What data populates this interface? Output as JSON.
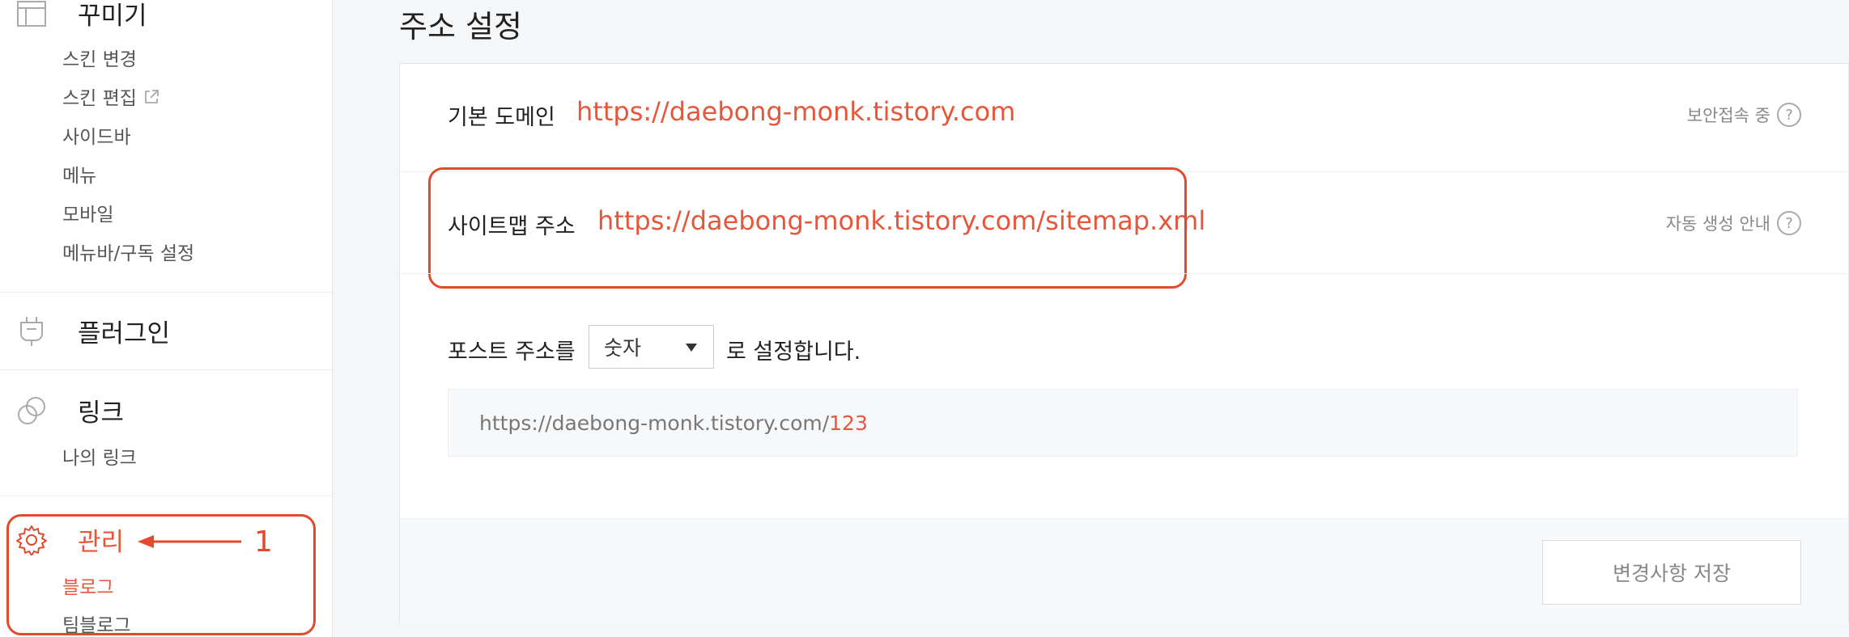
{
  "sidebar": {
    "decorate": {
      "title": "꾸미기",
      "items": [
        "스킨 변경",
        "스킨 편집",
        "사이드바",
        "메뉴",
        "모바일",
        "메뉴바/구독 설정"
      ]
    },
    "plugin": {
      "title": "플러그인"
    },
    "link": {
      "title": "링크",
      "items": [
        "나의 링크"
      ]
    },
    "manage": {
      "title": "관리",
      "items": [
        "블로그",
        "팀블로그"
      ]
    },
    "annotation_number": "1"
  },
  "main": {
    "title": "주소 설정",
    "domain": {
      "label": "기본 도메인",
      "url": "https://daebong-monk.tistory.com",
      "status": "보안접속 중"
    },
    "sitemap": {
      "label": "사이트맵 주소",
      "url": "https://daebong-monk.tistory.com/sitemap.xml",
      "guide": "자동 생성 안내"
    },
    "post_address": {
      "prefix": "포스트 주소를",
      "selected": "숫자",
      "suffix": "로 설정합니다.",
      "preview_base": "https://daebong-monk.tistory.com/",
      "preview_num": "123"
    },
    "save_label": "변경사항 저장",
    "help_glyph": "?"
  },
  "colors": {
    "accent": "#e8563a",
    "annotation": "#e24a2d"
  }
}
